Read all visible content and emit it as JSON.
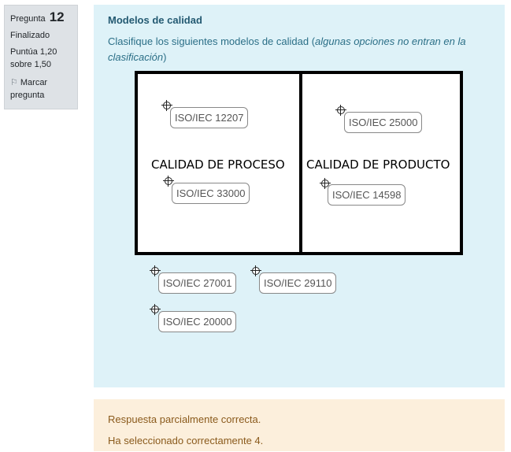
{
  "info": {
    "question_label": "Pregunta",
    "question_number": "12",
    "state": "Finalizado",
    "grade": "Puntúa 1,20 sobre 1,50",
    "flag_label": "Marcar pregunta"
  },
  "question": {
    "title": "Modelos de calidad",
    "prompt_start": "Clasifique los siguientes modelos de calidad (",
    "prompt_italic": "algunas opciones no entran en la clasificación",
    "prompt_end": ")"
  },
  "zones": {
    "left_label": "CALIDAD DE PROCESO",
    "right_label": "CALIDAD DE PRODUCTO"
  },
  "placed_items": {
    "p1": "ISO/IEC 12207",
    "p2": "ISO/IEC 33000",
    "p3": "ISO/IEC 25000",
    "p4": "ISO/IEC 14598"
  },
  "unplaced_items": {
    "u1": "ISO/IEC 27001",
    "u2": "ISO/IEC 29110",
    "u3": "ISO/IEC 20000"
  },
  "feedback": {
    "line1": "Respuesta parcialmente correcta.",
    "line2": "Ha seleccionado correctamente 4."
  },
  "colors": {
    "question_bg": "#def2f8",
    "feedback_bg": "#fcefdc",
    "info_bg": "#dee2e6"
  }
}
